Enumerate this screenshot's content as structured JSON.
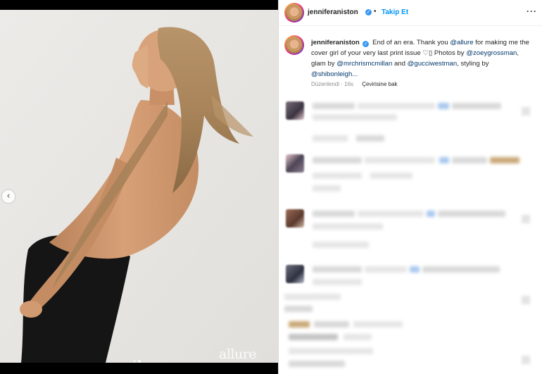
{
  "post": {
    "media": {
      "watermark": "allure",
      "carousel": {
        "slides": 2,
        "current": 2
      },
      "prev_icon": "chevron-left-icon"
    },
    "header": {
      "username": "jenniferaniston",
      "verified_icon": "verified-badge-icon",
      "separator": "•",
      "follow_label": "Takip Et",
      "more_icon": "more-horizontal-icon"
    },
    "caption": {
      "username": "jenniferaniston",
      "text_1": "End of an era. Thank you ",
      "mention_allure": "@allure",
      "text_2": " for making me the cover girl of your very last print issue ♡⁠▯ Photos by ",
      "mention_photographer": "@zoeygrossman",
      "text_3": ", glam by ",
      "mention_glam": "@mrchrismcmillan",
      "text_4": " and ",
      "mention_gucci": "@gucciwestman",
      "text_5": ", styling by ",
      "mention_styling": "@shibonleigh...",
      "edited": "Düzenlendi · 16s",
      "translate": "Çevirisine bak"
    },
    "comments": {
      "note": "",
      "count_visible": 5
    },
    "colors": {
      "link": "#00376b",
      "accent": "#0095f6",
      "text": "#262626",
      "muted": "#8e8e8e"
    }
  }
}
